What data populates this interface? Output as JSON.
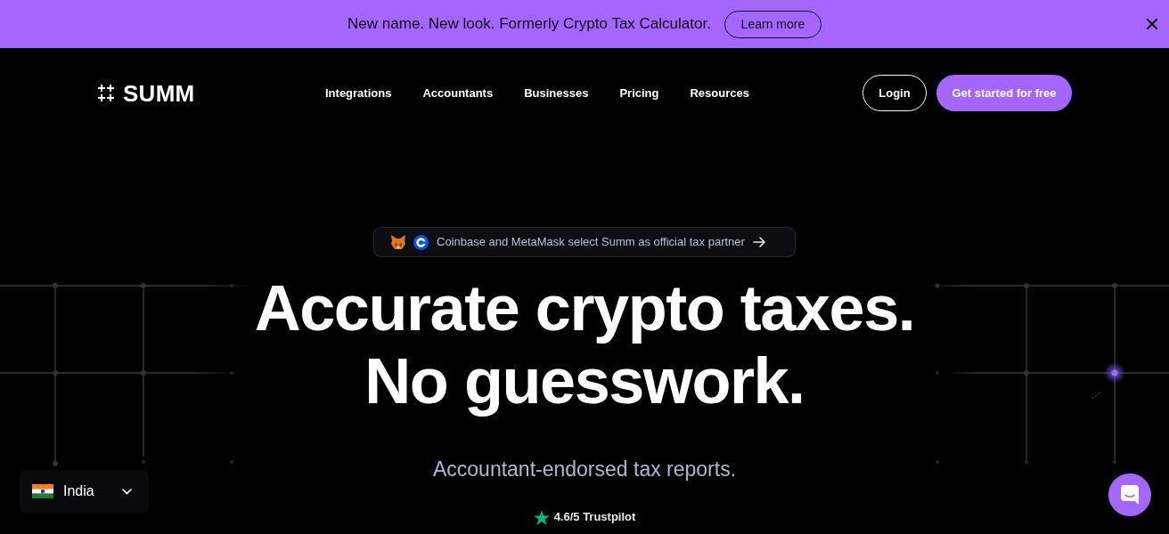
{
  "banner": {
    "message": "New name. New look. Formerly Crypto Tax Calculator.",
    "link": "Learn more"
  },
  "nav": {
    "logo": "SUMM",
    "links": [
      "Integrations",
      "Accountants",
      "Businesses",
      "Pricing",
      "Resources"
    ],
    "login": "Login",
    "cta": "Get started for free"
  },
  "announcement": {
    "text": "Coinbase and MetaMask select Summ as official tax partner"
  },
  "hero": {
    "headline": [
      "Accurate crypto taxes.",
      "No guesswork."
    ],
    "subtitle": "Accountant-endorsed tax reports.",
    "rating": "4.6/5 Trustpilot"
  },
  "region_selector": {
    "country": "India"
  }
}
